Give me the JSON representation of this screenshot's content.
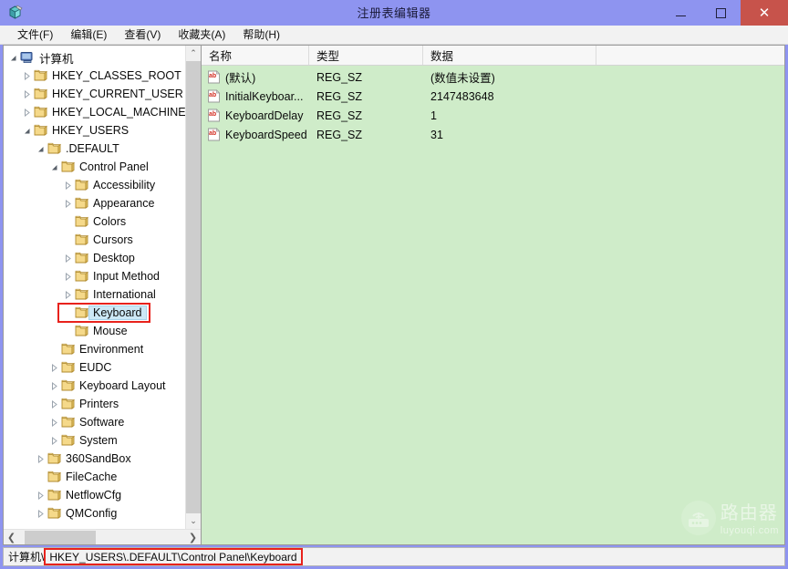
{
  "window": {
    "title": "注册表编辑器",
    "icon": "regedit-icon",
    "minimize_label": "最小化",
    "maximize_label": "最大化",
    "close_label": "关闭",
    "close_glyph": "✕",
    "titlebar_color": "#8e94f0",
    "close_button_color": "#c7534b"
  },
  "menubar": {
    "items": [
      {
        "label": "文件(F)",
        "name": "menu-file"
      },
      {
        "label": "编辑(E)",
        "name": "menu-edit"
      },
      {
        "label": "查看(V)",
        "name": "menu-view"
      },
      {
        "label": "收藏夹(A)",
        "name": "menu-favorites"
      },
      {
        "label": "帮助(H)",
        "name": "menu-help"
      }
    ]
  },
  "tree": {
    "root_label": "计算机",
    "root_icon": "computer-icon",
    "selected_key": "Keyboard",
    "selection_highlight_color": "#cde8f6",
    "annotation_color": "#e8221c",
    "nodes": [
      {
        "label": "HKEY_CLASSES_ROOT",
        "depth": 1,
        "state": "collapsed"
      },
      {
        "label": "HKEY_CURRENT_USER",
        "depth": 1,
        "state": "collapsed"
      },
      {
        "label": "HKEY_LOCAL_MACHINE",
        "depth": 1,
        "state": "collapsed"
      },
      {
        "label": "HKEY_USERS",
        "depth": 1,
        "state": "expanded"
      },
      {
        "label": ".DEFAULT",
        "depth": 2,
        "state": "expanded"
      },
      {
        "label": "Control Panel",
        "depth": 3,
        "state": "expanded"
      },
      {
        "label": "Accessibility",
        "depth": 4,
        "state": "collapsed"
      },
      {
        "label": "Appearance",
        "depth": 4,
        "state": "collapsed"
      },
      {
        "label": "Colors",
        "depth": 4,
        "state": "leaf"
      },
      {
        "label": "Cursors",
        "depth": 4,
        "state": "leaf"
      },
      {
        "label": "Desktop",
        "depth": 4,
        "state": "collapsed"
      },
      {
        "label": "Input Method",
        "depth": 4,
        "state": "collapsed"
      },
      {
        "label": "International",
        "depth": 4,
        "state": "collapsed"
      },
      {
        "label": "Keyboard",
        "depth": 4,
        "state": "leaf",
        "selected": true
      },
      {
        "label": "Mouse",
        "depth": 4,
        "state": "leaf"
      },
      {
        "label": "Environment",
        "depth": 3,
        "state": "leaf"
      },
      {
        "label": "EUDC",
        "depth": 3,
        "state": "collapsed"
      },
      {
        "label": "Keyboard Layout",
        "depth": 3,
        "state": "collapsed"
      },
      {
        "label": "Printers",
        "depth": 3,
        "state": "collapsed"
      },
      {
        "label": "Software",
        "depth": 3,
        "state": "collapsed"
      },
      {
        "label": "System",
        "depth": 3,
        "state": "collapsed"
      },
      {
        "label": "360SandBox",
        "depth": 2,
        "state": "collapsed"
      },
      {
        "label": "FileCache",
        "depth": 2,
        "state": "leaf"
      },
      {
        "label": "NetflowCfg",
        "depth": 2,
        "state": "collapsed"
      },
      {
        "label": "QMConfig",
        "depth": 2,
        "state": "collapsed"
      }
    ],
    "scroll_up_glyph": "⌃",
    "scroll_down_glyph": "⌄",
    "scroll_left_glyph": "❮",
    "scroll_right_glyph": "❯"
  },
  "list": {
    "background_color": "#cfecc9",
    "columns": [
      "名称",
      "类型",
      "数据"
    ],
    "rows": [
      {
        "name": "(默认)",
        "type": "REG_SZ",
        "data": "(数值未设置)",
        "icon": "string-value-icon"
      },
      {
        "name": "InitialKeyboar...",
        "type": "REG_SZ",
        "data": "2147483648",
        "icon": "string-value-icon"
      },
      {
        "name": "KeyboardDelay",
        "type": "REG_SZ",
        "data": "1",
        "icon": "string-value-icon"
      },
      {
        "name": "KeyboardSpeed",
        "type": "REG_SZ",
        "data": "31",
        "icon": "string-value-icon"
      }
    ]
  },
  "statusbar": {
    "prefix": "计算机\\",
    "path": "HKEY_USERS\\.DEFAULT\\Control Panel\\Keyboard",
    "annotation_color": "#e8221c"
  },
  "watermark": {
    "title": "路由器",
    "subtitle": "luyouqi.com",
    "icon": "router-icon"
  }
}
